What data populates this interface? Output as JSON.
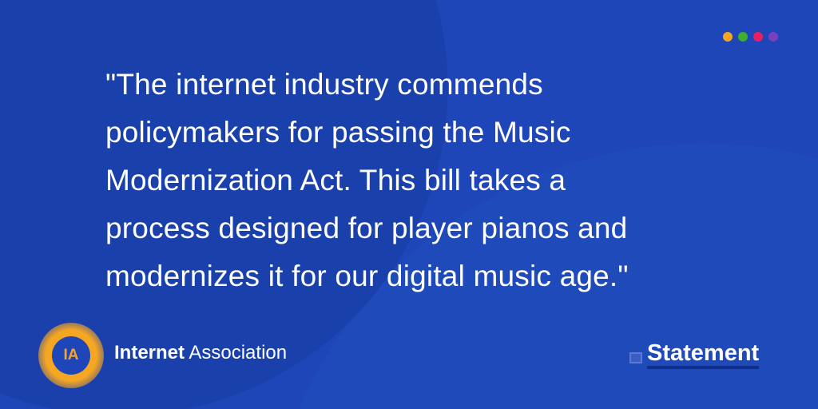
{
  "quote": "\"The internet industry commends policymakers for passing the Music Modernization Act. This bill takes a process designed for player pianos and modernizes it for our digital music age.\"",
  "quote_lines": [
    "\"The internet industry commends",
    "policymakers for passing the Music",
    "Modernization Act. This bill takes a",
    "process designed for player pianos and",
    "modernizes it for our digital music age.\""
  ],
  "dots": [
    "#f5a623",
    "#3fae2a",
    "#e91e63",
    "#7b3fbf"
  ],
  "logo": {
    "initials": "IA",
    "name_bold": "Internet",
    "name_rest": "Association"
  },
  "badge": "Statement",
  "colors": {
    "background": "#1e46b8",
    "accent": "#f5a623"
  }
}
